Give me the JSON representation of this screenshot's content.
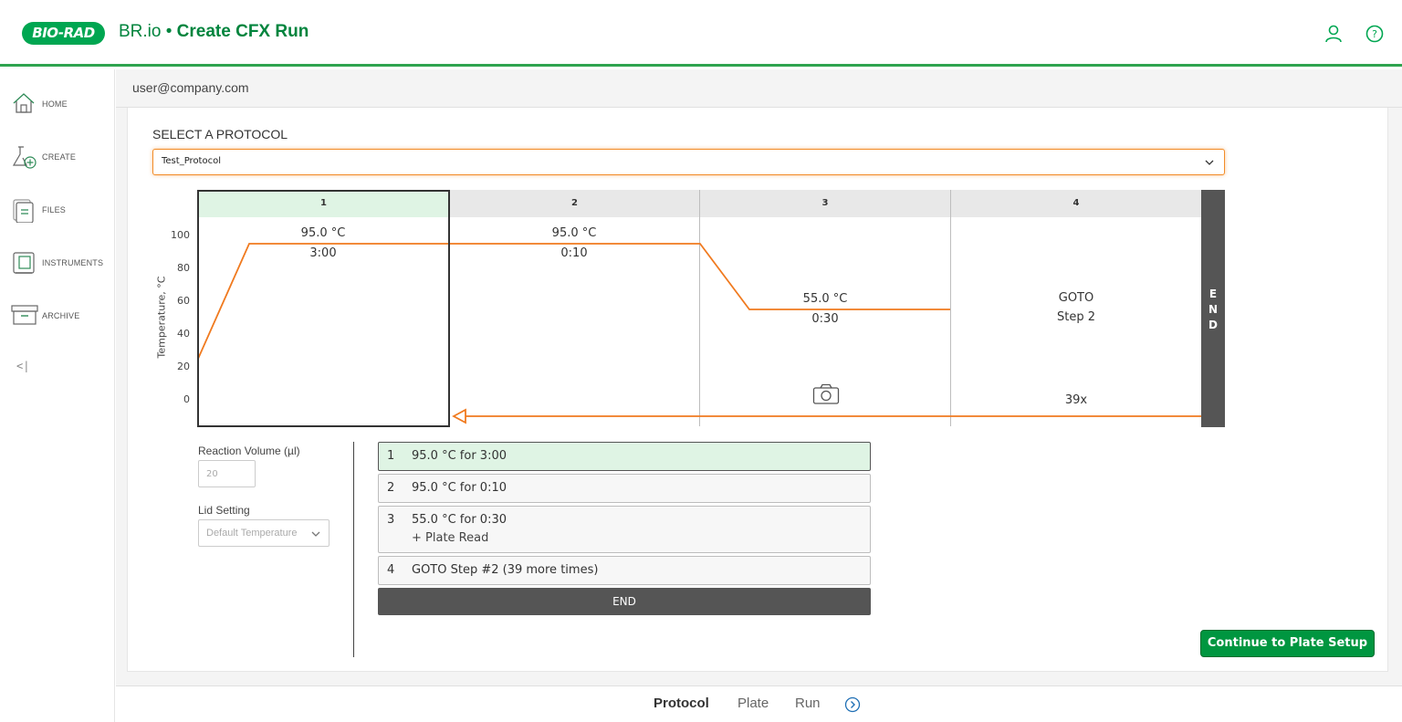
{
  "header": {
    "logo_text": "BIO-RAD",
    "title_prefix": "BR.io • ",
    "title_main": "Create CFX Run",
    "user_icon": "user-icon",
    "help_icon": "help-icon"
  },
  "sidebar": {
    "items": [
      {
        "label": "HOME",
        "icon": "home-icon"
      },
      {
        "label": "CREATE",
        "icon": "flask-plus-icon"
      },
      {
        "label": "FILES",
        "icon": "files-icon"
      },
      {
        "label": "INSTRUMENTS",
        "icon": "instrument-icon"
      },
      {
        "label": "ARCHIVE",
        "icon": "archive-icon"
      }
    ],
    "collapse_label": "<|"
  },
  "userbar": {
    "email": "user@company.com"
  },
  "protocol": {
    "select_label": "SELECT A PROTOCOL",
    "selected": "Test_Protocol"
  },
  "graph": {
    "y_axis_label": "Temperature, °C",
    "y_ticks": [
      "100",
      "80",
      "60",
      "40",
      "20",
      "0"
    ],
    "steps": [
      {
        "number": "1",
        "temp": "95.0 °C",
        "time": "3:00"
      },
      {
        "number": "2",
        "temp": "95.0 °C",
        "time": "0:10"
      },
      {
        "number": "3",
        "temp": "55.0 °C",
        "time": "0:30"
      },
      {
        "number": "4",
        "goto": "GOTO",
        "goto_step": "Step 2",
        "repeat": "39x"
      }
    ],
    "end_letters": [
      "E",
      "N",
      "D"
    ],
    "accent_color": "#f07a1f"
  },
  "settings": {
    "volume_label": "Reaction Volume (µl)",
    "volume_value": "20",
    "lid_label": "Lid Setting",
    "lid_value": "Default Temperature"
  },
  "step_list": [
    {
      "num": "1",
      "text": "95.0 °C for 3:00"
    },
    {
      "num": "2",
      "text": "95.0 °C for 0:10"
    },
    {
      "num": "3",
      "text": "55.0 °C for 0:30",
      "sub": "+ Plate Read"
    },
    {
      "num": "4",
      "text": "GOTO Step #2 (39 more times)"
    }
  ],
  "end_label": "END",
  "continue_label": "Continue to Plate Setup",
  "tabs": [
    "Protocol",
    "Plate",
    "Run"
  ],
  "colors": {
    "brand_green": "#009640",
    "accent_orange": "#f07a1f",
    "active_step": "#dff4e4"
  }
}
